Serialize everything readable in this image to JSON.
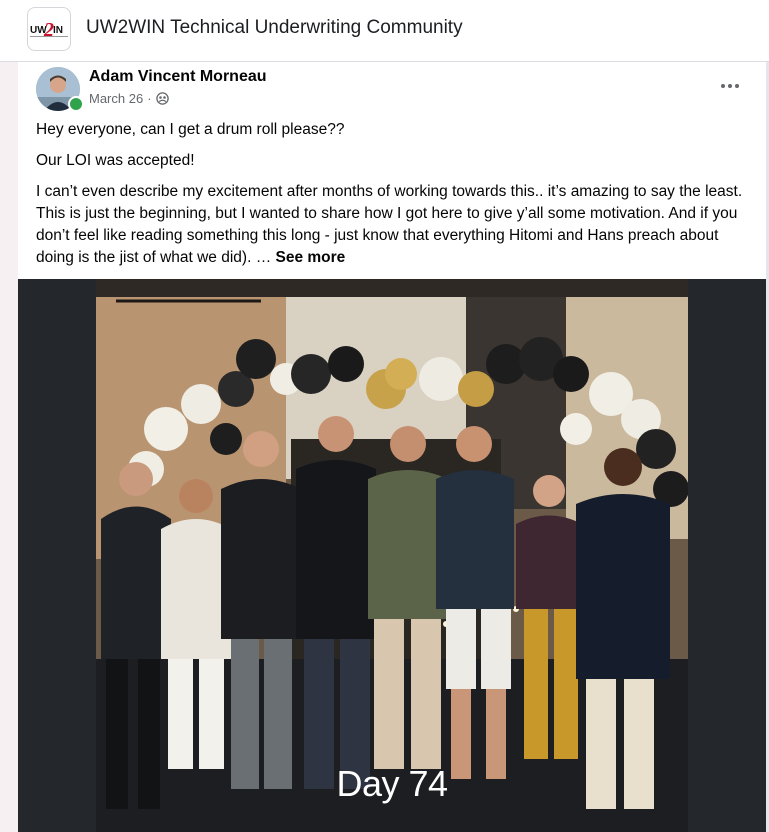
{
  "group": {
    "name": "UW2WIN Technical Underwriting Community",
    "logo_text": "UW2WIN",
    "logo_color": "#c8102e"
  },
  "post": {
    "author": "Adam Vincent Morneau",
    "date": "March 26",
    "separator": "·",
    "privacy_icon": "group-icon",
    "more_icon": "more-options-icon",
    "paragraphs": [
      "Hey everyone, can I get a drum roll please??",
      "Our LOI was accepted!",
      "I can’t even describe my excitement after months of working towards this.. it’s amazing to say the least. This is just the beginning, but I wanted to share how I got here to give y’all some motivation. And if you don’t feel like reading something this long - just know that everything Hitomi and Hans preach about doing is the jist of what we did)."
    ],
    "ellipsis": "…",
    "see_more": "See more",
    "photo_caption": "Day 74",
    "online_color": "#31a24c"
  }
}
